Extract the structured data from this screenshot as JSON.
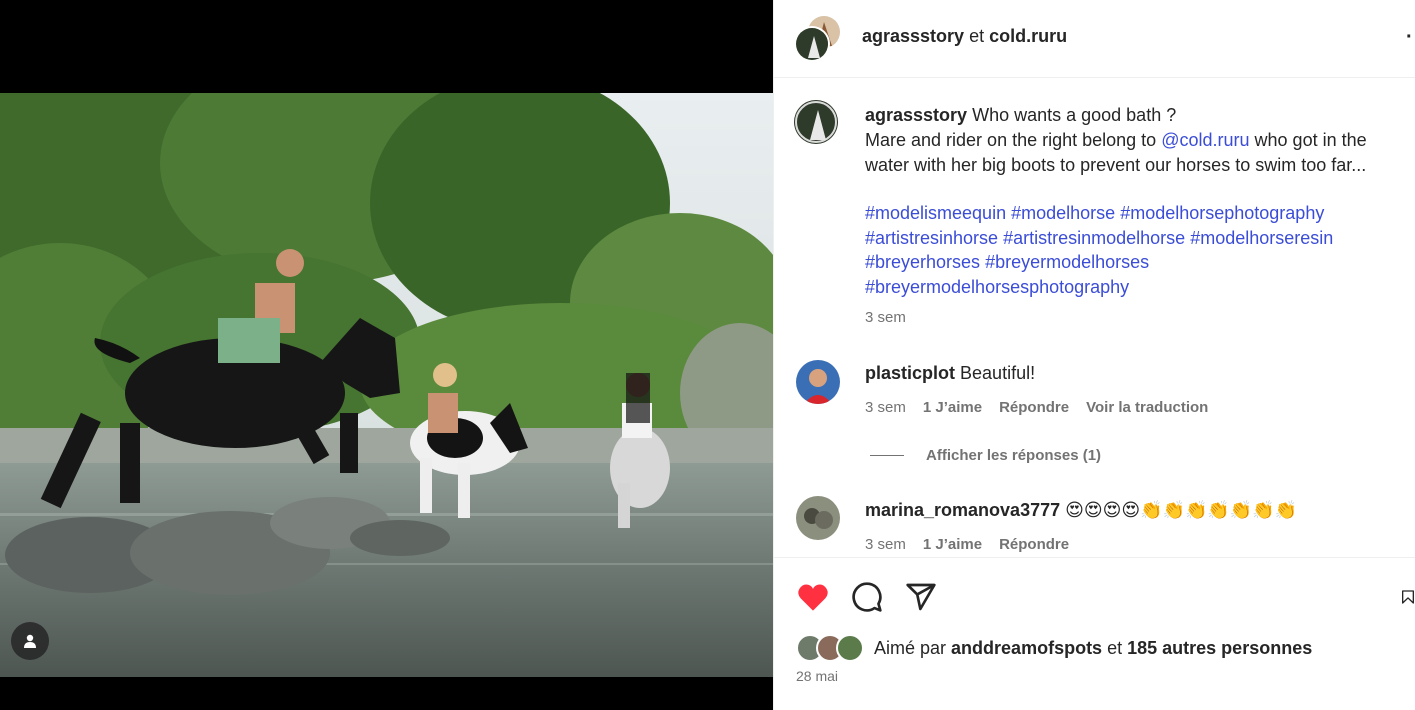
{
  "header": {
    "author1": "agrassstory",
    "connector": "et",
    "author2": "cold.ruru",
    "more_icon": "more-options-icon"
  },
  "caption": {
    "username": "agrassstory",
    "line1": "Who wants a good bath ?",
    "line2_before": "Mare and rider on the right belong to",
    "mention": "@cold.ruru",
    "line2_after": "who got in the water with her big boots to prevent our horses to swim too far...",
    "hashtags": [
      "#modelismeequin",
      "#modelhorse",
      "#modelhorsephotography",
      "#artistresinhorse",
      "#artistresinmodelhorse",
      "#modelhorseresin",
      "#breyerhorses",
      "#breyermodelhorses",
      "#breyermodelhorsesphotography"
    ],
    "time": "3 sem"
  },
  "comments": [
    {
      "username": "plasticplot",
      "text": "Beautiful!",
      "time": "3 sem",
      "likes": "1 J’aime",
      "reply": "Répondre",
      "translate": "Voir la traduction",
      "view_replies": "Afficher les réponses (1)"
    },
    {
      "username": "marina_romanova3777",
      "text": "😍😍😍😍👏👏👏👏👏👏👏",
      "time": "3 sem",
      "likes": "1 J’aime",
      "reply": "Répondre"
    }
  ],
  "actions": {
    "liked": true,
    "like_color": "#ff3040",
    "icons": [
      "heart-icon",
      "comment-icon",
      "share-icon",
      "bookmark-icon"
    ]
  },
  "likes": {
    "prefix": "Aimé par",
    "user": "anddreamofspots",
    "connector": "et",
    "others": "185 autres personnes"
  },
  "date": "28 mai",
  "colors": {
    "link": "#3b4dd6",
    "muted": "#737373",
    "text": "#262626"
  }
}
